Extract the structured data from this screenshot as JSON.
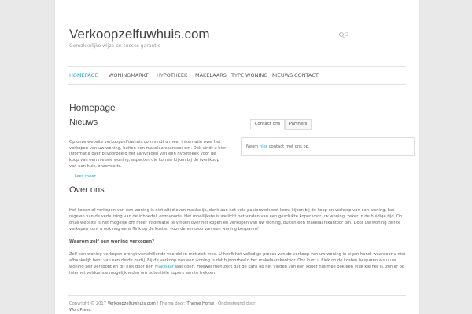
{
  "header": {
    "site_title": "Verkoopzelfuwhuis.com",
    "tagline": "Gemakkelijke wijze en succes garantie",
    "search_icon": "search-icon",
    "search_count": "2"
  },
  "nav": {
    "items": [
      {
        "label": "HOMEPAGE",
        "active": true
      },
      {
        "label": "WONINGMARKT"
      },
      {
        "label": "HYPOTHEEK"
      },
      {
        "label": "MAKELAARS"
      },
      {
        "label": "TYPE WONING"
      },
      {
        "label": "NIEUWS"
      },
      {
        "label": "CONTACT"
      }
    ]
  },
  "main": {
    "page_title": "Homepage",
    "news_heading": "Nieuws",
    "news_intro": "Op onze website verkoopzelfuwhuis.com vindt u meer informatie over het verkopen van uw woning, buiten een makelaarskantoor om. Ook vindt u hier informatie over bijvoorbeeld het aanvragen van een hypotheek voor de koop van een nieuwe woning, aspecten die komen kijken bij de (ver)koop van een huis, enzovoorts.",
    "read_more_prefix": "...",
    "read_more": "Lees meer",
    "tabs": [
      "Contact ons",
      "Partners"
    ],
    "tab_text_before": "Neem",
    "tab_link": "hier",
    "tab_text_after": "contact met ons op.",
    "over_heading": "Over ons",
    "over_p1": "Het kopen of verkopen van een woning is niet altijd even makkelijk, denk aan het vele papierwerk wat komt kijken bij de koop en verkoop van een woning, het regelen van de verhuizing van de inboedel, enzovoorts. Het moeilijkste is wellicht het vinden van een geschikte koper voor uw woning, zeker in de huidige tijd. Op onze website is het mogelijk om meer informatie te vinden over het kopen en verkopen van uw woning, buiten een makelaarskantoor om. Door uw woning zelf te verkopen kunt u ook nog eens flink op de kosten voor de verkoop van een woning besparen!",
    "over_sub": "Waarom zelf een woning verkopen?",
    "over_p2_before": "Zelf een woning verkopen brengt verschillende voordelen met zich mee. U heeft het volledige proces van de verkoop van uw woning in eigen hand, waardoor u niet afhankelijk bent van een derde partij. Bij de verkoop van een woning is dat bijvoorbeeld het makelaarskantoor. Ook kunt u flink op de kosten besparen als u uw woning zelf verkoopt en dit niet door een",
    "over_p2_link": "makelaar",
    "over_p2_after": "laat doen. Hoewel men zegt dat de kans op het vinden van een koper hiermee ook een stuk kleiner is, zijn er op internet voldoende mogelijkheden om potentiële kopers aan te trekken."
  },
  "footer": {
    "copyright": "Copyright © 2017",
    "site_link": "Verkoopzelfuwhuis.com",
    "theme_text": "| Thema door:",
    "theme_link": "Theme Horse",
    "support_text": "| Ondersteund door:",
    "support_link": "WordPress."
  }
}
